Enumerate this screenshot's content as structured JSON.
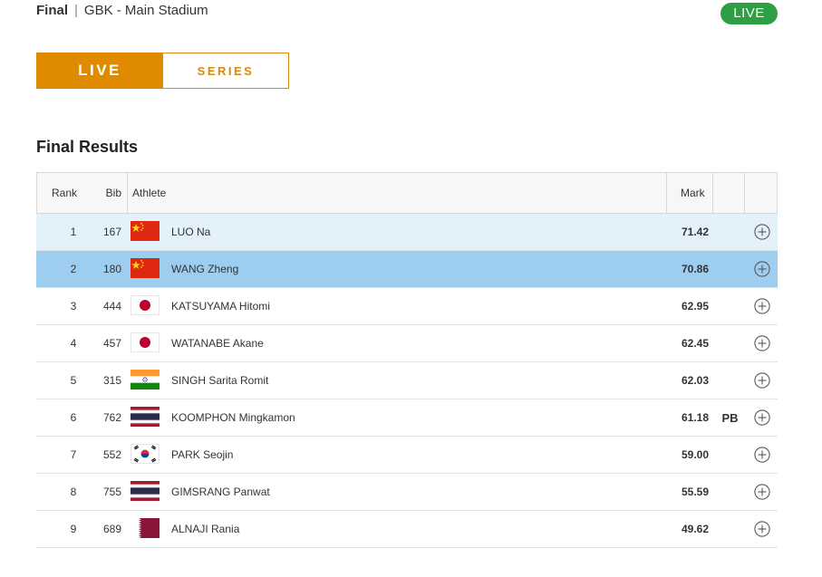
{
  "header": {
    "stage": "Final",
    "separator": "|",
    "venue": "GBK - Main Stadium",
    "live_badge": "LIVE"
  },
  "tabs": {
    "live_label": "LIVE",
    "series_label": "SERIES"
  },
  "section_title": "Final Results",
  "table": {
    "headers": {
      "rank": "Rank",
      "bib": "Bib",
      "athlete": "Athlete",
      "mark": "Mark"
    },
    "rows": [
      {
        "rank": "1",
        "bib": "167",
        "flag": "china-flag-icon",
        "name": "LUO Na",
        "mark": "71.42",
        "pb": ""
      },
      {
        "rank": "2",
        "bib": "180",
        "flag": "china-flag-icon",
        "name": "WANG Zheng",
        "mark": "70.86",
        "pb": ""
      },
      {
        "rank": "3",
        "bib": "444",
        "flag": "japan-flag-icon",
        "name": "KATSUYAMA Hitomi",
        "mark": "62.95",
        "pb": ""
      },
      {
        "rank": "4",
        "bib": "457",
        "flag": "japan-flag-icon",
        "name": "WATANABE Akane",
        "mark": "62.45",
        "pb": ""
      },
      {
        "rank": "5",
        "bib": "315",
        "flag": "india-flag-icon",
        "name": "SINGH Sarita Romit",
        "mark": "62.03",
        "pb": ""
      },
      {
        "rank": "6",
        "bib": "762",
        "flag": "thailand-flag-icon",
        "name": "KOOMPHON Mingkamon",
        "mark": "61.18",
        "pb": "PB"
      },
      {
        "rank": "7",
        "bib": "552",
        "flag": "korea-flag-icon",
        "name": "PARK Seojin",
        "mark": "59.00",
        "pb": ""
      },
      {
        "rank": "8",
        "bib": "755",
        "flag": "thailand-flag-icon",
        "name": "GIMSRANG Panwat",
        "mark": "55.59",
        "pb": ""
      },
      {
        "rank": "9",
        "bib": "689",
        "flag": "qatar-flag-icon",
        "name": "ALNAJI Rania",
        "mark": "49.62",
        "pb": ""
      }
    ],
    "expand_icon": "plus-circle-icon"
  },
  "colors": {
    "accent_orange": "#e08a00",
    "live_green": "#2ea043",
    "row_first_bg": "#e3f1fa",
    "row_highlight_bg": "#9dcdef"
  }
}
